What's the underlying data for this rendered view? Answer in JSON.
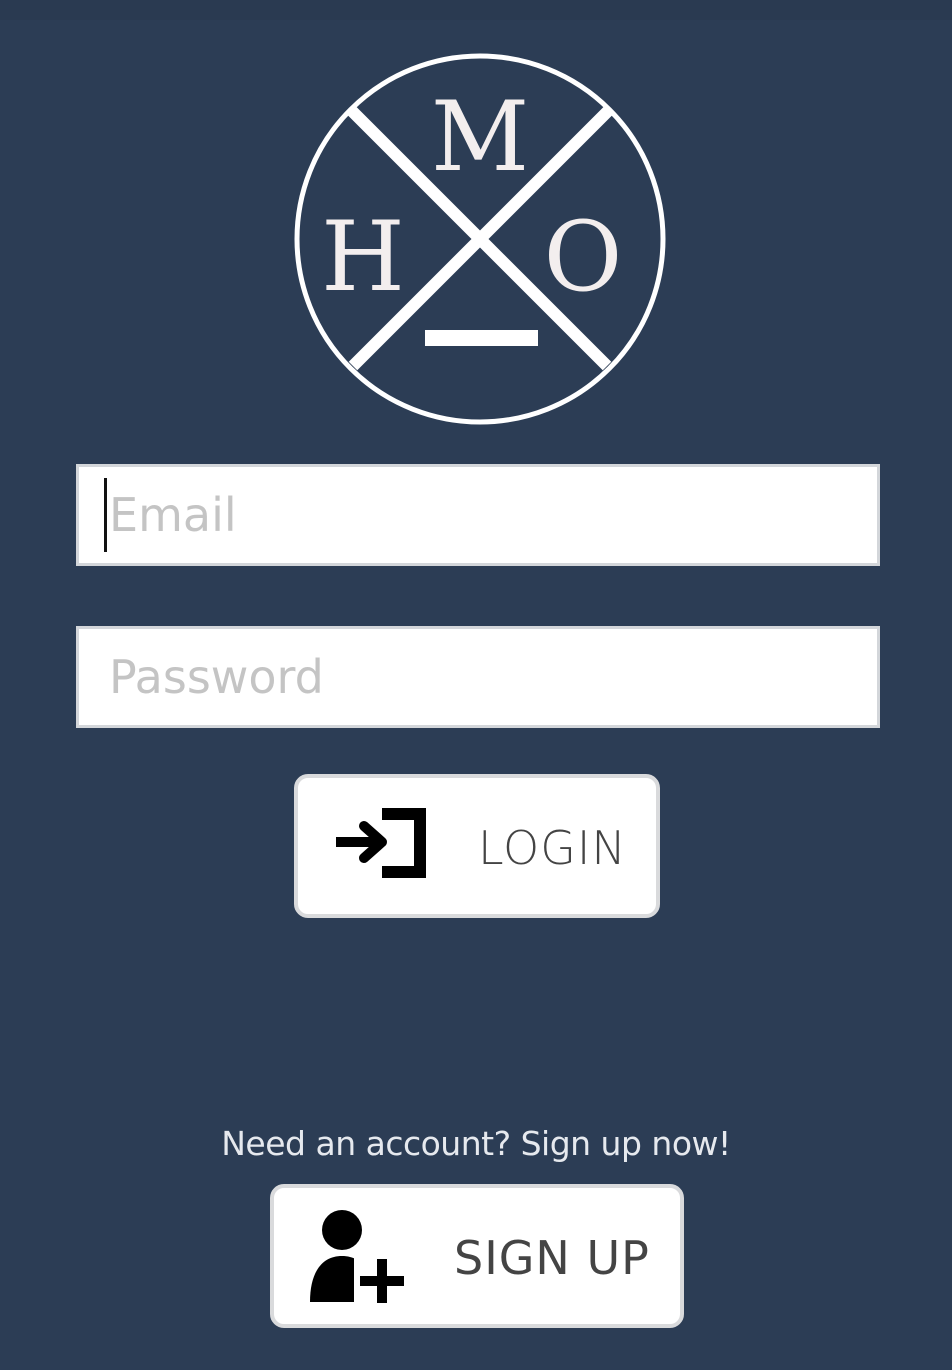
{
  "logo": {
    "letter_top": "M",
    "letter_left": "H",
    "letter_right": "O",
    "icon": "hmo-crossed-circle-logo"
  },
  "form": {
    "email_placeholder": "Email",
    "email_value": "",
    "password_placeholder": "Password",
    "password_value": ""
  },
  "login_button": {
    "label": "LOGIN",
    "icon": "login-arrow-icon"
  },
  "signup": {
    "prompt": "Need an account? Sign up now!",
    "button_label": "SIGN UP",
    "icon": "add-user-icon"
  },
  "colors": {
    "background": "#2c3d55",
    "field_background": "#ffffff",
    "logo_stroke": "#ffffff",
    "logo_letters": "#f3eeee"
  }
}
